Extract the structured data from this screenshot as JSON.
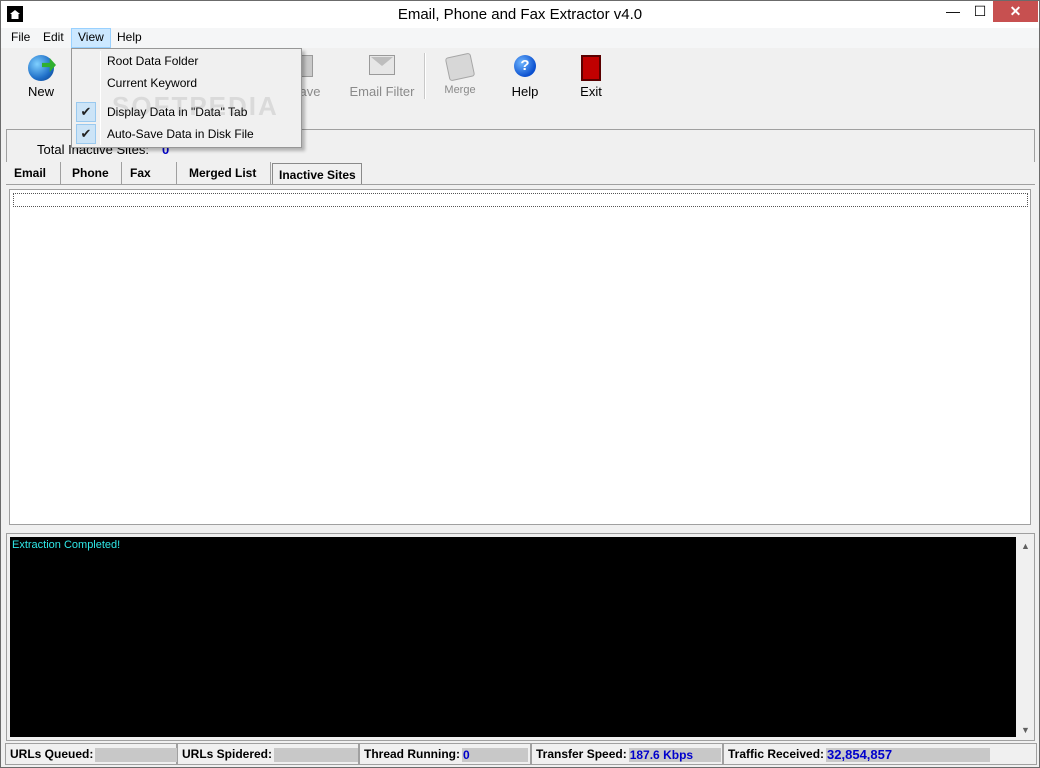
{
  "window": {
    "title": "Email, Phone and Fax Extractor v4.0",
    "minimize_glyph": "—",
    "maximize_glyph": "☐",
    "close_glyph": "✕"
  },
  "menu": {
    "items": [
      "File",
      "Edit",
      "View",
      "Help"
    ],
    "active": "View"
  },
  "view_menu": {
    "items": [
      {
        "label": "Root Data Folder",
        "checked": false
      },
      {
        "label": "Current Keyword",
        "checked": false
      },
      {
        "label": "Display Data in \"Data\" Tab",
        "checked": true
      },
      {
        "label": "Auto-Save Data in Disk File",
        "checked": true
      }
    ],
    "check_glyph": "✔"
  },
  "toolbar": {
    "new_label": "New",
    "save_label": "ave",
    "email_filter_label": "Email Filter",
    "merge_label": "Merge",
    "help_label": "Help",
    "help_glyph": "?",
    "exit_label": "Exit"
  },
  "watermark": "SOFTPEDIA",
  "stats": {
    "label": "Total Inactive Sites:",
    "value": "0"
  },
  "tabs": [
    "Email",
    "Phone",
    "Fax",
    "Merged List",
    "Inactive Sites"
  ],
  "selected_tab": "Inactive Sites",
  "log": {
    "text": "Extraction Completed!",
    "scroll_up_glyph": "▲",
    "scroll_down_glyph": "▼"
  },
  "status": {
    "urls_queued_label": "URLs Queued:",
    "urls_spidered_label": "URLs Spidered:",
    "thread_running_label": "Thread Running:",
    "thread_running_value": "0",
    "transfer_speed_label": "Transfer Speed:",
    "transfer_speed_value": "187.6 Kbps",
    "traffic_received_label": "Traffic Received:",
    "traffic_received_value": "32,854,857"
  },
  "colors": {
    "menu_highlight": "#cce8ff",
    "log_background": "#000000",
    "log_text": "#2fe8e8",
    "status_value": "#0000cc",
    "close_button": "#c75050"
  }
}
